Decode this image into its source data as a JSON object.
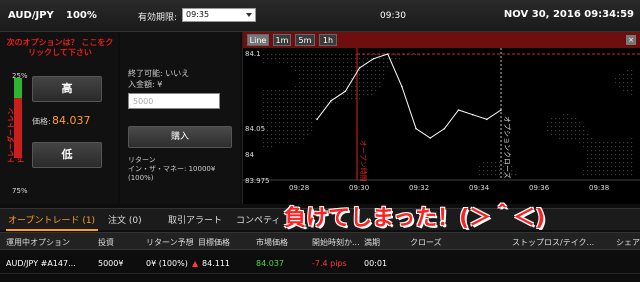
{
  "topbar": {
    "pair": "AUD/JPY",
    "payout": "100%",
    "expiry_label": "有効期限:",
    "expiry_value": "09:35",
    "center_time": "09:30",
    "datetime": "NOV 30, 2016 09:34:59"
  },
  "left": {
    "promo": "次のオプションは？ ここをクリックして下さい",
    "gauge_top": "25%",
    "gauge_bottom": "75%",
    "gauge_high_fraction": 0.25,
    "vertical_label": "トレーダートレンド",
    "high_button": "高",
    "low_button": "低",
    "price_label": "価格:",
    "price_value": "84.037"
  },
  "middle": {
    "can_close": "終了可能: いいえ",
    "deposit_label": "入金額: ¥",
    "amount_placeholder": "5000",
    "buy_button": "購入",
    "return_label": "リターン",
    "return_detail": "イン・ザ・マネー: 10000¥ (100%)"
  },
  "chart": {
    "timeframes": [
      "Line",
      "1m",
      "5m",
      "1h"
    ],
    "active_timeframe": "Line",
    "y_ticks": [
      "84.1",
      "84.05",
      "84",
      "83.975"
    ],
    "x_ticks": [
      "09:28",
      "09:30",
      "09:32",
      "09:34",
      "09:36",
      "09:38"
    ],
    "label_open": "オープン時間",
    "label_close": "オプションクローズ",
    "close_icon": "×"
  },
  "tabs": {
    "items": [
      "オープントレード (1)",
      "注文 (0)",
      "取引アラート",
      "コンペティ"
    ],
    "active": 0,
    "overlay": "負けてしまった！(＞＾＜)"
  },
  "table": {
    "headers": [
      "運用中オプション",
      "投資",
      "リターン予想",
      "目標価格",
      "市場価格",
      "開始時刻か...",
      "満期",
      "クローズ",
      "ストップロス/テイク...",
      "シェア"
    ],
    "row": {
      "asset": "AUD/JPY #A147...",
      "invest": "5000¥",
      "return": "0¥ (100%)",
      "target": "84.111",
      "market": "84.037",
      "pips": "-7.4 pips",
      "expiry": "00:01"
    }
  },
  "chart_data": {
    "type": "line",
    "ylim": [
      83.975,
      84.11
    ],
    "x": [
      "09:28",
      "09:30",
      "09:32",
      "09:34",
      "09:36",
      "09:38"
    ],
    "series": [
      {
        "values": [
          84.04,
          84.06,
          84.07,
          84.095,
          84.105,
          84.11,
          84.075,
          84.03,
          84.02,
          84.03,
          84.05,
          84.045,
          84.04,
          84.05
        ]
      }
    ],
    "grid": false
  }
}
